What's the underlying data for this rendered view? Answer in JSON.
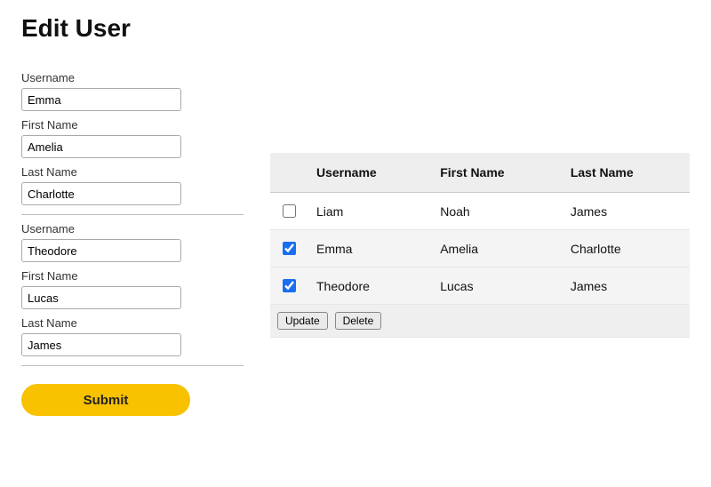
{
  "page": {
    "title": "Edit User"
  },
  "form": {
    "groups": [
      {
        "username_label": "Username",
        "username_value": "Emma",
        "firstname_label": "First Name",
        "firstname_value": "Amelia",
        "lastname_label": "Last Name",
        "lastname_value": "Charlotte"
      },
      {
        "username_label": "Username",
        "username_value": "Theodore",
        "firstname_label": "First Name",
        "firstname_value": "Lucas",
        "lastname_label": "Last Name",
        "lastname_value": "James"
      }
    ],
    "submit_label": "Submit"
  },
  "table": {
    "headers": {
      "username": "Username",
      "firstname": "First Name",
      "lastname": "Last Name"
    },
    "rows": [
      {
        "checked": false,
        "username": "Liam",
        "firstname": "Noah",
        "lastname": "James"
      },
      {
        "checked": true,
        "username": "Emma",
        "firstname": "Amelia",
        "lastname": "Charlotte"
      },
      {
        "checked": true,
        "username": "Theodore",
        "firstname": "Lucas",
        "lastname": "James"
      }
    ],
    "actions": {
      "update": "Update",
      "delete": "Delete"
    }
  }
}
